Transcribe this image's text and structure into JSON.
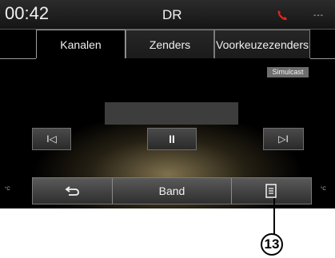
{
  "status_bar": {
    "time": "00:42",
    "station": "DR",
    "phone_icon": "phone-icon",
    "signal_text": "---",
    "signal_icon": "signal-icon"
  },
  "tabs": [
    {
      "label": "Kanalen",
      "active": true
    },
    {
      "label": "Zenders",
      "active": false
    },
    {
      "label": "Voorkeuzezenders",
      "active": false
    }
  ],
  "badge": "Simulcast",
  "controls": {
    "prev_label": "I◁",
    "pause_label": "II",
    "next_label": "▷I"
  },
  "bottom_bar": {
    "back_icon": "back-icon",
    "band_label": "Band",
    "list_icon": "list-icon"
  },
  "temperature": {
    "left": "°C",
    "right": "°C"
  },
  "callout": "13",
  "colors": {
    "phone": "#e0261b",
    "glow": "#e6cd8c"
  }
}
